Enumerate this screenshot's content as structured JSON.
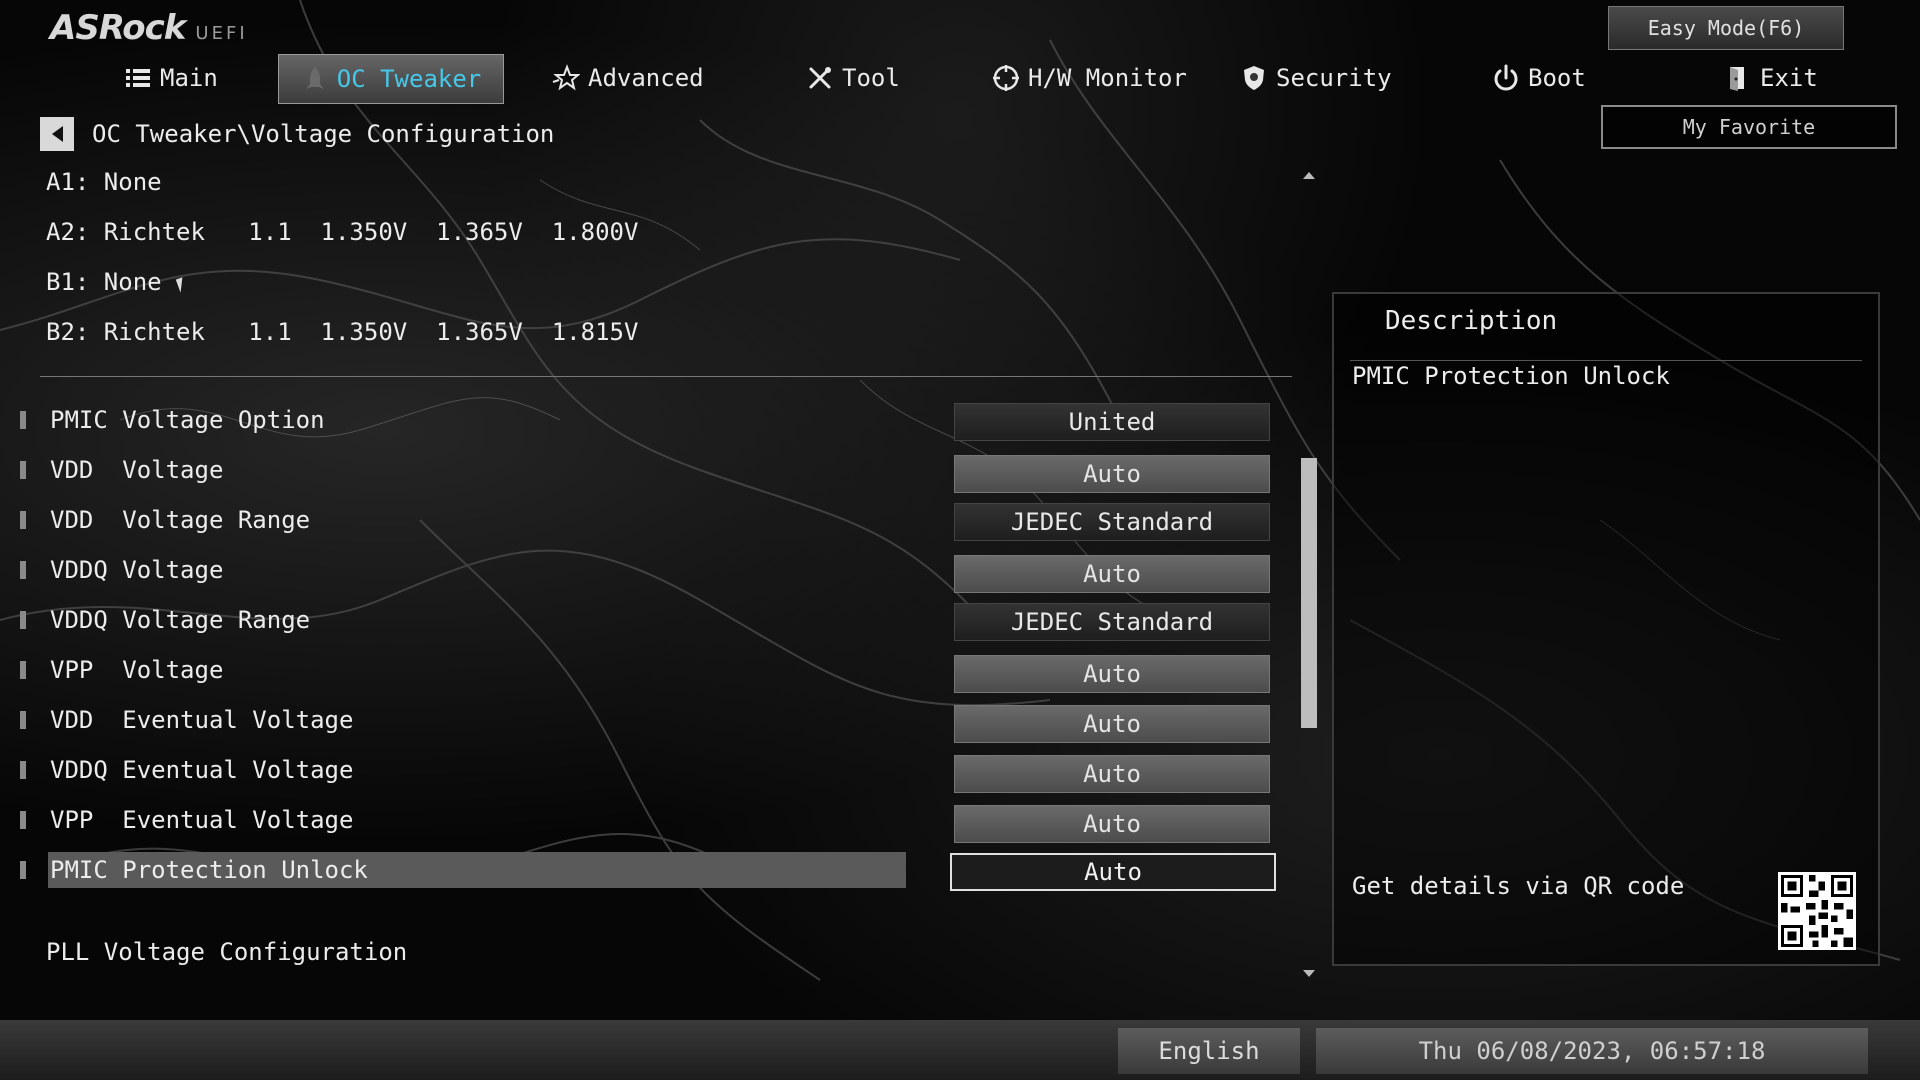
{
  "brand": {
    "logo": "ASRock",
    "sub": "UEFI"
  },
  "header": {
    "easy_mode": "Easy Mode(F6)",
    "favorite": "My Favorite"
  },
  "tabs": [
    {
      "label": "Main",
      "icon": "list-icon"
    },
    {
      "label": "OC Tweaker",
      "icon": "rocket-icon",
      "active": true
    },
    {
      "label": "Advanced",
      "icon": "star-icon"
    },
    {
      "label": "Tool",
      "icon": "tools-icon"
    },
    {
      "label": "H/W Monitor",
      "icon": "crosshair-icon"
    },
    {
      "label": "Security",
      "icon": "shield-icon"
    },
    {
      "label": "Boot",
      "icon": "power-icon"
    },
    {
      "label": "Exit",
      "icon": "exit-door-icon"
    }
  ],
  "breadcrumb": "OC Tweaker\\Voltage Configuration",
  "dimm_info": [
    "A1: None",
    "A2: Richtek   1.1  1.350V  1.365V  1.800V",
    "B1: None",
    "B2: Richtek   1.1  1.350V  1.365V  1.815V"
  ],
  "settings": [
    {
      "label": "PMIC Voltage Option",
      "value": "United",
      "style": "dark"
    },
    {
      "label": "VDD  Voltage",
      "value": "Auto",
      "style": "light"
    },
    {
      "label": "VDD  Voltage Range",
      "value": "JEDEC Standard",
      "style": "dark"
    },
    {
      "label": "VDDQ Voltage",
      "value": "Auto",
      "style": "light"
    },
    {
      "label": "VDDQ Voltage Range",
      "value": "JEDEC Standard",
      "style": "dark"
    },
    {
      "label": "VPP  Voltage",
      "value": "Auto",
      "style": "light"
    },
    {
      "label": "VDD  Eventual Voltage",
      "value": "Auto",
      "style": "light"
    },
    {
      "label": "VDDQ Eventual Voltage",
      "value": "Auto",
      "style": "light"
    },
    {
      "label": "VPP  Eventual Voltage",
      "value": "Auto",
      "style": "light"
    },
    {
      "label": "PMIC Protection Unlock",
      "value": "Auto",
      "style": "selected"
    }
  ],
  "submenu": "PLL Voltage Configuration",
  "description": {
    "title": "Description",
    "text": "PMIC Protection Unlock",
    "qr_hint": "Get details via QR code"
  },
  "footer": {
    "language": "English",
    "datetime": "Thu 06/08/2023, 06:57:18"
  },
  "colors": {
    "accent": "#47c8e8",
    "selected_row": "#5a5a5a"
  }
}
